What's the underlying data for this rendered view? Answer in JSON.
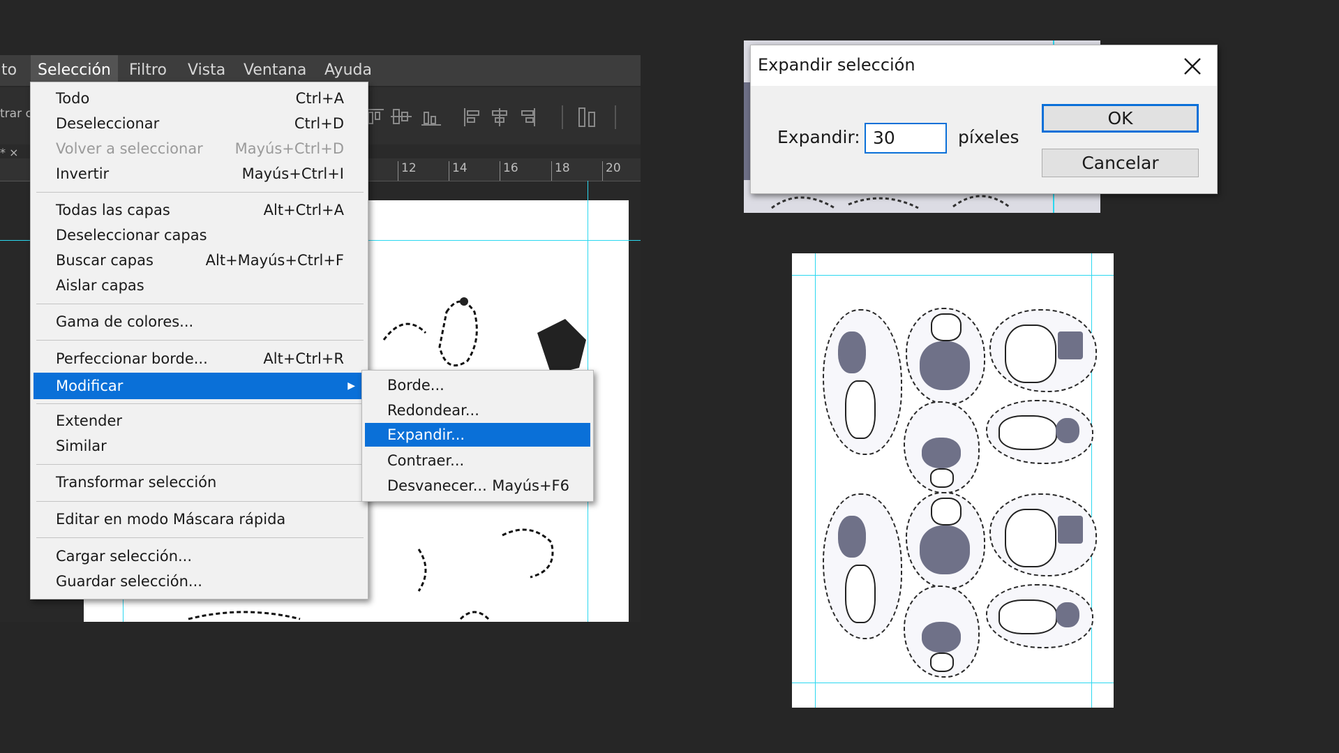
{
  "menubar": {
    "items": [
      "to",
      "Selección",
      "Filtro",
      "Vista",
      "Ventana",
      "Ayuda"
    ],
    "active": "Selección"
  },
  "toolbar": {
    "left_text": "trar c"
  },
  "tabs": {
    "tab_fragment": "* ×"
  },
  "ruler": {
    "ticks": [
      "12",
      "14",
      "16",
      "18",
      "20"
    ]
  },
  "seleccion_menu": {
    "items": [
      {
        "label": "Todo",
        "shortcut": "Ctrl+A"
      },
      {
        "label": "Deseleccionar",
        "shortcut": "Ctrl+D"
      },
      {
        "label": "Volver a seleccionar",
        "shortcut": "Mayús+Ctrl+D",
        "disabled": true
      },
      {
        "label": "Invertir",
        "shortcut": "Mayús+Ctrl+I"
      },
      {
        "label": "Todas las capas",
        "shortcut": "Alt+Ctrl+A"
      },
      {
        "label": "Deseleccionar capas",
        "shortcut": ""
      },
      {
        "label": "Buscar capas",
        "shortcut": "Alt+Mayús+Ctrl+F"
      },
      {
        "label": "Aislar capas",
        "shortcut": ""
      },
      {
        "label": "Gama de colores...",
        "shortcut": ""
      },
      {
        "label": "Perfeccionar borde...",
        "shortcut": "Alt+Ctrl+R"
      },
      {
        "label": "Modificar",
        "shortcut": "",
        "highlighted": true,
        "submenu": true
      },
      {
        "label": "Extender",
        "shortcut": ""
      },
      {
        "label": "Similar",
        "shortcut": ""
      },
      {
        "label": "Transformar selección",
        "shortcut": ""
      },
      {
        "label": "Editar en modo Máscara rápida",
        "shortcut": ""
      },
      {
        "label": "Cargar selección...",
        "shortcut": ""
      },
      {
        "label": "Guardar selección...",
        "shortcut": ""
      }
    ]
  },
  "modificar_submenu": {
    "items": [
      {
        "label": "Borde...",
        "shortcut": ""
      },
      {
        "label": "Redondear...",
        "shortcut": ""
      },
      {
        "label": "Expandir...",
        "shortcut": "",
        "highlighted": true
      },
      {
        "label": "Contraer...",
        "shortcut": ""
      },
      {
        "label": "Desvanecer...",
        "shortcut": "Mayús+F6"
      }
    ]
  },
  "dialog": {
    "title": "Expandir selección",
    "field_label": "Expandir:",
    "field_value": "30",
    "unit": "píxeles",
    "ok_label": "OK",
    "cancel_label": "Cancelar"
  },
  "colors": {
    "highlight": "#0a70d8",
    "guide": "#2bd8f0",
    "background": "#262626",
    "sticker_fill": "#6f7188"
  }
}
